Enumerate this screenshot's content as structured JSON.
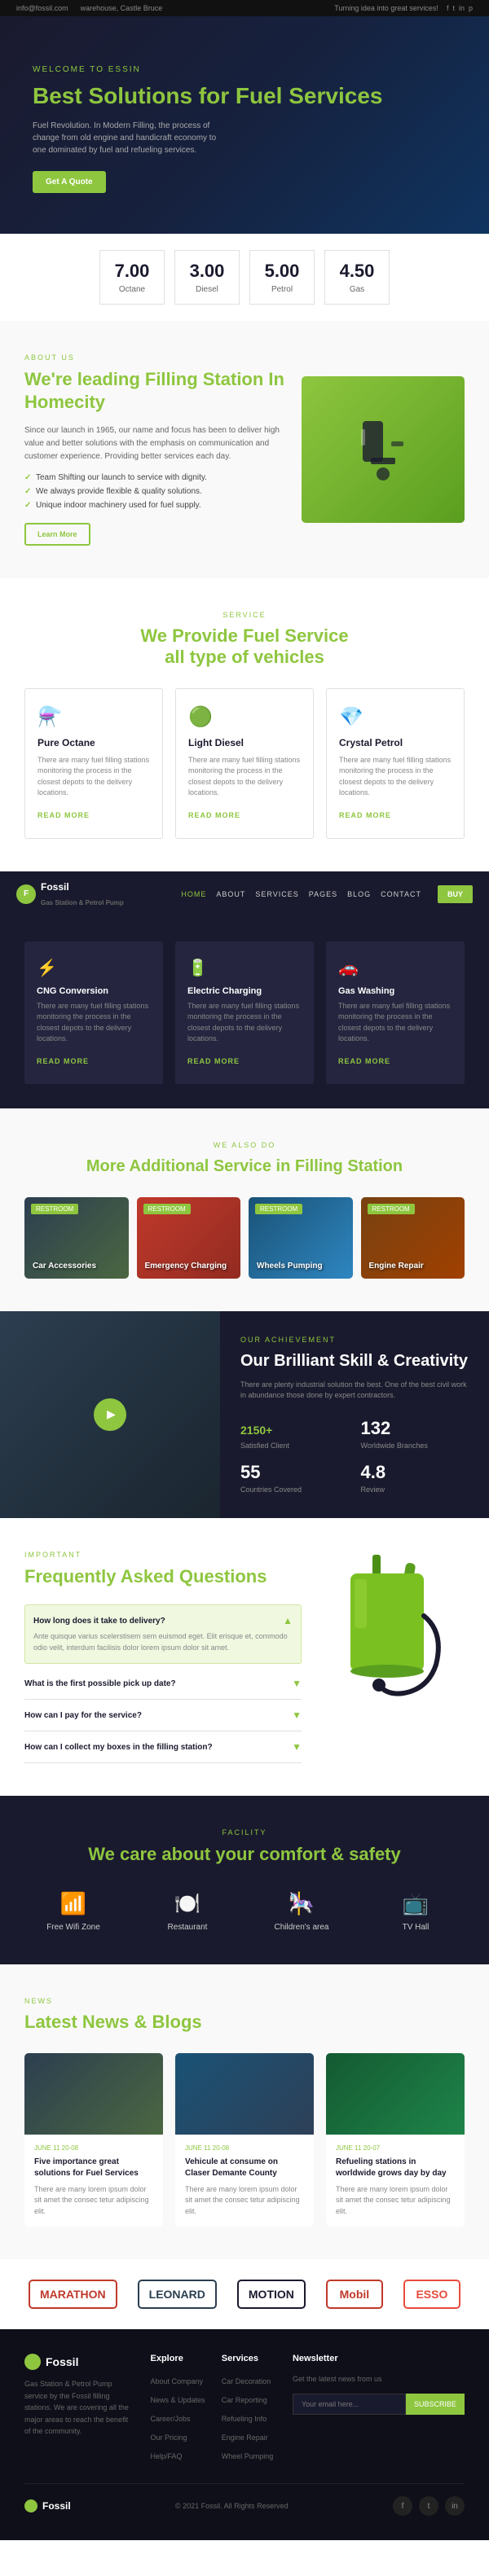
{
  "topbar": {
    "email": "info@fossil.com",
    "location": "warehouse, Castle Bruce",
    "tagline": "Turning idea into great services!",
    "social": [
      "f",
      "t",
      "in",
      "p"
    ]
  },
  "hero": {
    "label": "WELCOME TO ESSIN",
    "title_plain": "Best Solutions for ",
    "title_highlight": "Fuel",
    "title_end": " Services",
    "description": "Fuel Revolution. In Modern Filling, the process of change from old engine and handicraft economy to one dominated by fuel and refueling services.",
    "cta": "Get A Quote"
  },
  "fuel_prices": [
    {
      "price": "7.00",
      "type": "Octane"
    },
    {
      "price": "3.00",
      "type": "Diesel"
    },
    {
      "price": "5.00",
      "type": "Petrol"
    },
    {
      "price": "4.50",
      "type": "Gas"
    }
  ],
  "about": {
    "label": "ABOUT US",
    "title_part1": "We're leading ",
    "title_highlight": "Filling Station",
    "title_part2": " In Homecity",
    "description": "Since our launch in 1965, our name and focus has been to deliver high value and better solutions with the emphasis on communication and customer experience. Providing better services each day.",
    "list": [
      "Team Shifting our launch to service with dignity.",
      "We always provide flexible & quality solutions.",
      "Unique indoor machinery used for fuel supply."
    ],
    "cta": "Learn More"
  },
  "services_section": {
    "label": "SERVICE",
    "title_plain": "We Provide ",
    "title_highlight": "Fuel Service",
    "title_end": " all type of ",
    "title_highlight2": "vehicles",
    "cards": [
      {
        "icon": "⚗️",
        "title": "Pure Octane",
        "description": "There are many fuel filling stations monitoring the process in the closest depots to the delivery locations.",
        "link": "READ MORE"
      },
      {
        "icon": "🟢",
        "title": "Light Diesel",
        "description": "There are many fuel filling stations monitoring the process in the closest depots to the delivery locations.",
        "link": "READ MORE"
      },
      {
        "icon": "💎",
        "title": "Crystal Petrol",
        "description": "There are many fuel filling stations monitoring the process in the closest depots to the delivery locations.",
        "link": "READ MORE"
      }
    ]
  },
  "navbar": {
    "logo": "Fossil",
    "subtitle": "Gas Station & Petrol Pump",
    "links": [
      "HOME",
      "ABOUT",
      "SERVICES",
      "PAGES",
      "BLOG",
      "CONTACT",
      "BUY"
    ],
    "active_link": "HOME"
  },
  "dark_services": {
    "cards": [
      {
        "icon": "⚡",
        "title": "CNG Conversion",
        "description": "There are many fuel filling stations monitoring the process in the closest depots to the delivery locations.",
        "link": "READ MORE"
      },
      {
        "icon": "🔋",
        "title": "Electric Charging",
        "description": "There are many fuel filling stations monitoring the process in the closest depots to the delivery locations.",
        "link": "READ MORE"
      },
      {
        "icon": "🚗",
        "title": "Gas Washing",
        "description": "There are many fuel filling stations monitoring the process in the closest depots to the delivery locations.",
        "link": "READ MORE"
      }
    ]
  },
  "additional": {
    "label": "WE ALSO DO",
    "title_plain": "More ",
    "title_highlight": "Additional",
    "title_end": " Service in Filling Station",
    "cards": [
      {
        "label": "RESTROOM",
        "title": "Car Accessories",
        "style": "car"
      },
      {
        "label": "RESTROOM",
        "title": "Emergency Charging",
        "style": "emergency"
      },
      {
        "label": "RESTROOM",
        "title": "Wheels Pumping",
        "style": "wheels"
      },
      {
        "label": "RESTROOM",
        "title": "Engine Repair",
        "style": "engine"
      }
    ]
  },
  "achievement": {
    "label": "OUR ACHIEVEMENT",
    "title": "Our Brilliant Skill & Creativity",
    "description": "There are plenty industrial solution the best. One of the best civil work in abundance those done by expert contractors.",
    "stats": [
      {
        "num": "2150",
        "suffix": "+",
        "desc": "Satisfied Client"
      },
      {
        "num": "132",
        "suffix": "",
        "desc": "Worldwide Branches"
      },
      {
        "num": "55",
        "suffix": "",
        "desc": "Countries Covered"
      },
      {
        "num": "4.8",
        "suffix": "",
        "desc": "Review"
      }
    ]
  },
  "faq": {
    "label": "IMPORTANT",
    "title_plain": "Frequently Asked ",
    "title_highlight": "Questions",
    "items": [
      {
        "question": "How long does it take to delivery?",
        "answer": "Ante quisque varius scelerstisem sem euismod eget. Elit erisque et, commodo odio velit, interdum facilisis dolor lorem ipsum dolor sit amet.",
        "open": true
      },
      {
        "question": "What is the first possible pick up date?",
        "answer": "",
        "open": false
      },
      {
        "question": "How can I pay for the service?",
        "answer": "",
        "open": false
      },
      {
        "question": "How can I collect my boxes in the filling station?",
        "answer": "",
        "open": false
      }
    ]
  },
  "comfort": {
    "label": "FACILITY",
    "title_plain": "We ",
    "title_highlight1": "care",
    "title_plain2": " about your comfort & ",
    "title_highlight2": "safety",
    "items": [
      {
        "icon": "📶",
        "label": "Free Wifi Zone"
      },
      {
        "icon": "🍽️",
        "label": "Restaurant"
      },
      {
        "icon": "🎠",
        "label": "Children's area"
      },
      {
        "icon": "📺",
        "label": "TV Hall"
      }
    ]
  },
  "news": {
    "label": "NEWS",
    "title_plain": "Latest News & ",
    "title_highlight": "Blogs",
    "cards": [
      {
        "date": "JUNE 11  20-08",
        "title": "Five importance great solutions for Fuel Services",
        "description": "There are many lorem ipsum dolor sit amet the consec tetur adipiscing elit.",
        "style": "img1"
      },
      {
        "date": "JUNE 11  20-08",
        "title": "Vehicule at consume on Claser Demante County",
        "description": "There are many lorem ipsum dolor sit amet the consec tetur adipiscing elit.",
        "style": "img2"
      },
      {
        "date": "JUNE 11  20-07",
        "title": "Refueling stations in worldwide grows day by day",
        "description": "There are many lorem ipsum dolor sit amet the consec tetur adipiscing elit.",
        "style": "img3"
      }
    ]
  },
  "brands": [
    "MARATHON",
    "LEONARD",
    "MOTION",
    "Mobil",
    "ESSO"
  ],
  "footer": {
    "logo": "Fossil",
    "about_text": "Gas Station & Petrol Pump service by the Fossil filling stations. We are covering all the major areas to reach the benefit of the community.",
    "explore_title": "Explore",
    "explore_links": [
      "About Company",
      "News & Updates",
      "Career/Jobs",
      "Our Pricing",
      "Help/FAQ"
    ],
    "services_title": "Services",
    "services_links": [
      "Car Decoration",
      "Car Reporting",
      "Refueling Info",
      "Engine Repair",
      "Wheel Pumping"
    ],
    "newsletter_title": "Newsletter",
    "newsletter_text": "Get the latest news from us",
    "newsletter_placeholder": "Your email here...",
    "newsletter_btn": "SUBSCRIBE",
    "copyright": "© 2021 Fossil. All Rights Reserved"
  }
}
